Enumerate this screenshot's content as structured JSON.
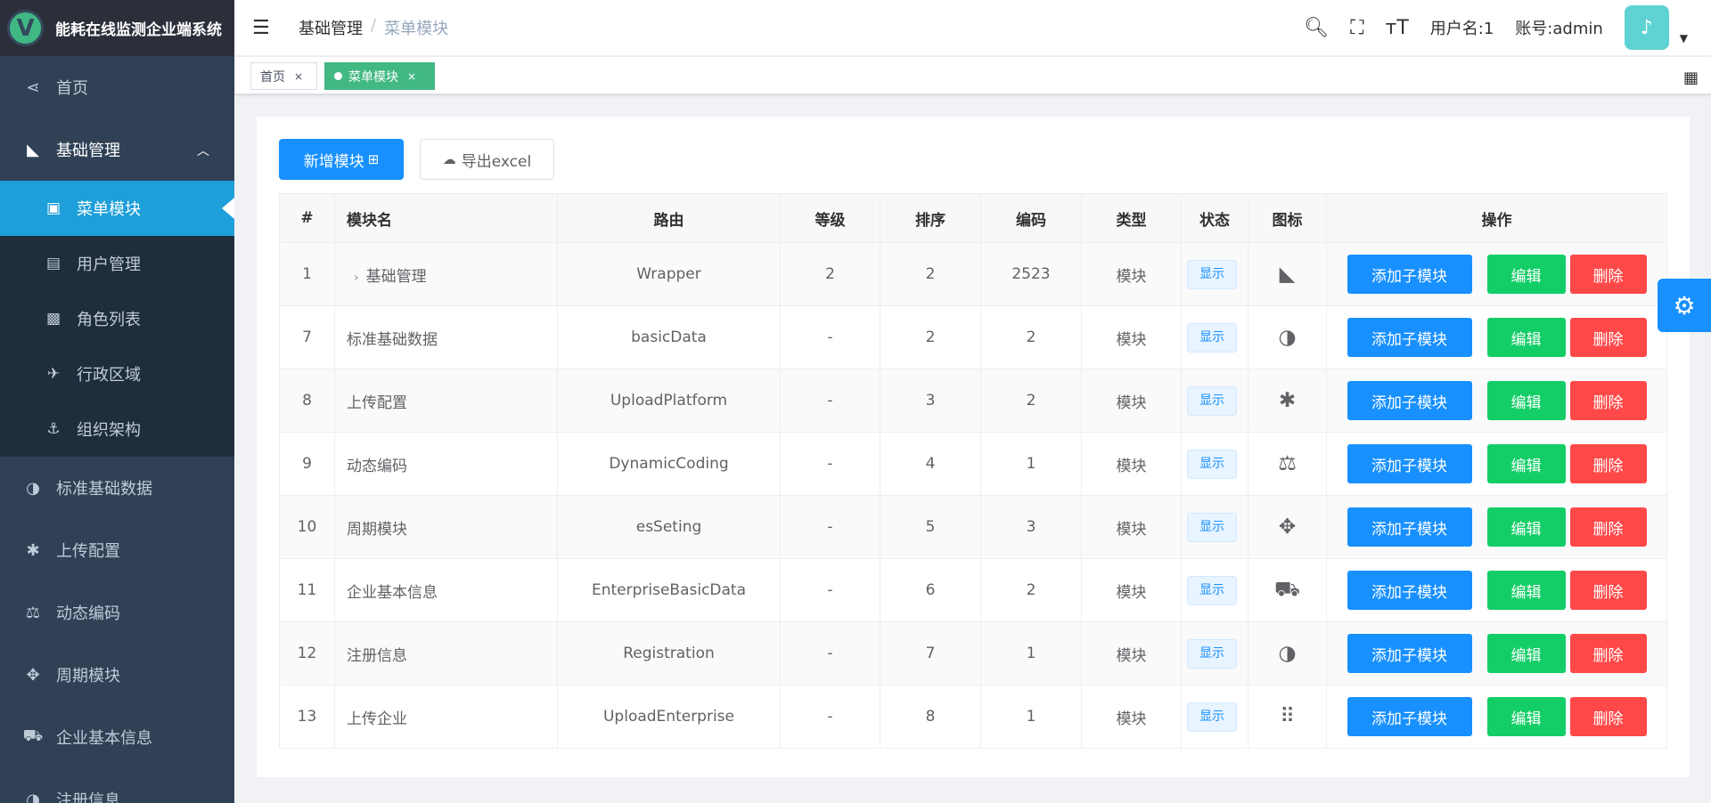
{
  "app": {
    "title": "能耗在线监测企业端系统",
    "logo_letter": "V"
  },
  "sidebar": {
    "home": "首页",
    "basic": "基础管理",
    "sub": [
      {
        "label": "菜单模块",
        "icon": "address-card-icon"
      },
      {
        "label": "用户管理",
        "icon": "id-card-icon"
      },
      {
        "label": "角色列表",
        "icon": "user-square-icon"
      },
      {
        "label": "行政区域",
        "icon": "map-icon"
      },
      {
        "label": "组织架构",
        "icon": "anchor-icon"
      }
    ],
    "items": [
      {
        "label": "标准基础数据",
        "icon": "half-circle-icon"
      },
      {
        "label": "上传配置",
        "icon": "asterisk-icon"
      },
      {
        "label": "动态编码",
        "icon": "balance-scale-icon"
      },
      {
        "label": "周期模块",
        "icon": "arrows-move-icon"
      },
      {
        "label": "企业基本信息",
        "icon": "car-icon"
      },
      {
        "label": "注册信息",
        "icon": "half-circle-icon"
      }
    ]
  },
  "header": {
    "breadcrumb": [
      "基础管理",
      "菜单模块"
    ],
    "username": "用户名:1",
    "account": "账号:admin"
  },
  "tags": {
    "home": "首页",
    "active": "菜单模块",
    "close": "×"
  },
  "toolbar": {
    "add": "新增模块",
    "export": "导出excel"
  },
  "table": {
    "headers": [
      "#",
      "模块名",
      "路由",
      "等级",
      "排序",
      "编码",
      "类型",
      "状态",
      "图标",
      "操作"
    ],
    "rows": [
      {
        "id": "1",
        "name": "基础管理",
        "route": "Wrapper",
        "level": "2",
        "sort": "2",
        "code": "2523",
        "type": "模块",
        "status": "显示",
        "icon": "area-chart-icon",
        "glyph": "◣"
      },
      {
        "id": "7",
        "name": "标准基础数据",
        "route": "basicData",
        "level": "-",
        "sort": "2",
        "code": "2",
        "type": "模块",
        "status": "显示",
        "icon": "half-circle-icon",
        "glyph": "◑"
      },
      {
        "id": "8",
        "name": "上传配置",
        "route": "UploadPlatform",
        "level": "-",
        "sort": "3",
        "code": "2",
        "type": "模块",
        "status": "显示",
        "icon": "asterisk-icon",
        "glyph": "✱"
      },
      {
        "id": "9",
        "name": "动态编码",
        "route": "DynamicCoding",
        "level": "-",
        "sort": "4",
        "code": "1",
        "type": "模块",
        "status": "显示",
        "icon": "balance-scale-icon",
        "glyph": "⚖"
      },
      {
        "id": "10",
        "name": "周期模块",
        "route": "esSeting",
        "level": "-",
        "sort": "5",
        "code": "3",
        "type": "模块",
        "status": "显示",
        "icon": "arrows-move-icon",
        "glyph": "✥"
      },
      {
        "id": "11",
        "name": "企业基本信息",
        "route": "EnterpriseBasicData",
        "level": "-",
        "sort": "6",
        "code": "2",
        "type": "模块",
        "status": "显示",
        "icon": "car-icon",
        "glyph": "⛟"
      },
      {
        "id": "12",
        "name": "注册信息",
        "route": "Registration",
        "level": "-",
        "sort": "7",
        "code": "1",
        "type": "模块",
        "status": "显示",
        "icon": "half-circle-icon",
        "glyph": "◑"
      },
      {
        "id": "13",
        "name": "上传企业",
        "route": "UploadEnterprise",
        "level": "-",
        "sort": "8",
        "code": "1",
        "type": "模块",
        "status": "显示",
        "icon": "braille-icon",
        "glyph": "⠿"
      }
    ],
    "actions": {
      "add_child": "添加子模块",
      "edit": "编辑",
      "delete": "删除"
    }
  },
  "colors": {
    "primary": "#1890ff",
    "success": "#13ce66",
    "danger": "#ff4949",
    "sidebar": "#304156",
    "active_tag": "#42b983"
  }
}
